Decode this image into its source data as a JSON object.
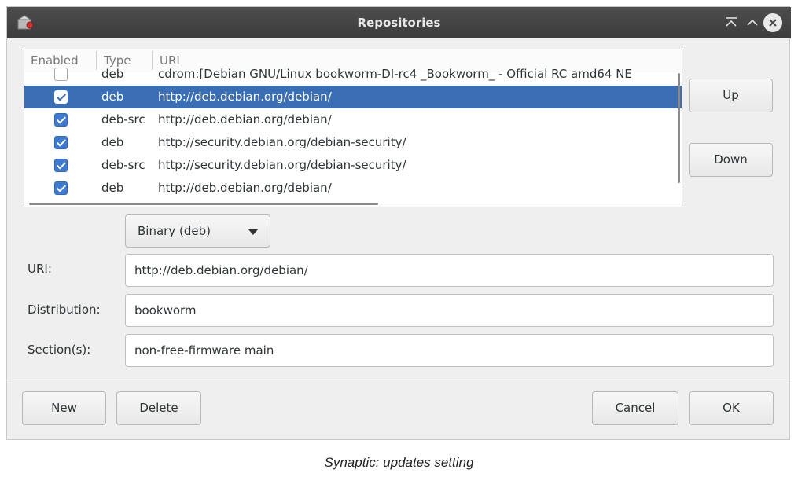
{
  "window": {
    "title": "Repositories"
  },
  "list": {
    "headers": {
      "enabled": "Enabled",
      "type": "Type",
      "uri": "URI"
    },
    "rows": [
      {
        "enabled": false,
        "type": "deb",
        "uri": "cdrom:[Debian GNU/Linux bookworm-DI-rc4 _Bookworm_ - Official RC amd64 NE",
        "selected": false
      },
      {
        "enabled": true,
        "type": "deb",
        "uri": "http://deb.debian.org/debian/",
        "selected": true
      },
      {
        "enabled": true,
        "type": "deb-src",
        "uri": "http://deb.debian.org/debian/",
        "selected": false
      },
      {
        "enabled": true,
        "type": "deb",
        "uri": "http://security.debian.org/debian-security/",
        "selected": false
      },
      {
        "enabled": true,
        "type": "deb-src",
        "uri": "http://security.debian.org/debian-security/",
        "selected": false
      },
      {
        "enabled": true,
        "type": "deb",
        "uri": "http://deb.debian.org/debian/",
        "selected": false
      }
    ]
  },
  "side_buttons": {
    "up": "Up",
    "down": "Down"
  },
  "type_select": {
    "value": "Binary (deb)"
  },
  "form": {
    "uri_label": "URI:",
    "uri_value": "http://deb.debian.org/debian/",
    "distribution_label": "Distribution:",
    "distribution_value": "bookworm",
    "sections_label": "Section(s):",
    "sections_value": "non-free-firmware main"
  },
  "footer": {
    "new": "New",
    "delete": "Delete",
    "cancel": "Cancel",
    "ok": "OK"
  },
  "caption": "Synaptic: updates setting",
  "colors": {
    "selection": "#3b6fb5",
    "checkbox": "#3d7bd3",
    "titlebar": "#444444"
  },
  "icons": {
    "app": "synaptic-app-icon",
    "shade": "shade-icon",
    "maximize": "maximize-icon",
    "close": "close-icon"
  }
}
